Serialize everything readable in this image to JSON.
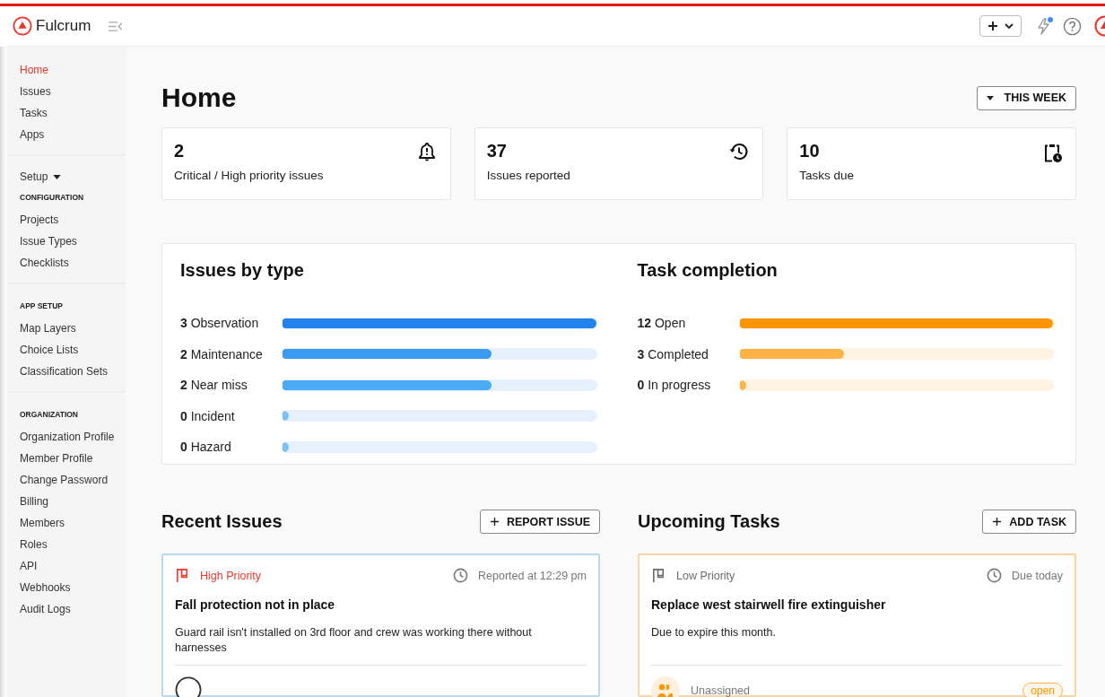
{
  "header": {
    "brand": "Fulcrum",
    "notifications_unread": true
  },
  "sidebar": {
    "groups": [
      {
        "items": [
          {
            "label": "Home",
            "selected": true
          },
          {
            "label": "Issues",
            "selected": false
          },
          {
            "label": "Tasks",
            "selected": false
          },
          {
            "label": "Apps",
            "selected": false
          }
        ]
      },
      {
        "toggle": "Setup",
        "heading": "CONFIGURATION",
        "items": [
          {
            "label": "Projects",
            "selected": false
          },
          {
            "label": "Issue Types",
            "selected": false
          },
          {
            "label": "Checklists",
            "selected": false
          }
        ]
      },
      {
        "heading": "APP SETUP",
        "items": [
          {
            "label": "Map Layers",
            "selected": false
          },
          {
            "label": "Choice Lists",
            "selected": false
          },
          {
            "label": "Classification Sets",
            "selected": false
          }
        ]
      },
      {
        "heading": "ORGANIZATION",
        "items": [
          {
            "label": "Organization Profile",
            "selected": false
          },
          {
            "label": "Member Profile",
            "selected": false
          },
          {
            "label": "Change Password",
            "selected": false
          },
          {
            "label": "Billing",
            "selected": false
          },
          {
            "label": "Members",
            "selected": false
          },
          {
            "label": "Roles",
            "selected": false
          },
          {
            "label": "API",
            "selected": false
          },
          {
            "label": "Webhooks",
            "selected": false
          },
          {
            "label": "Audit Logs",
            "selected": false
          }
        ]
      }
    ]
  },
  "page": {
    "title": "Home",
    "period_button": "THIS WEEK"
  },
  "stats": [
    {
      "kind": "alert",
      "value": "2",
      "label": "Critical / High priority issues"
    },
    {
      "kind": "history",
      "value": "37",
      "label": "Issues reported"
    },
    {
      "kind": "tasks",
      "value": "10",
      "label": "Tasks due"
    }
  ],
  "breakdowns": [
    {
      "title": "Issues by type",
      "rows": [
        {
          "count": "3",
          "label": "Observation",
          "level": 1,
          "color": "#2383ee"
        },
        {
          "count": "2",
          "label": "Maintenance",
          "level": 0.667,
          "color": "#3a9af0"
        },
        {
          "count": "2",
          "label": "Near miss",
          "level": 0.667,
          "color": "#4aacf5"
        },
        {
          "count": "0",
          "label": "Incident",
          "level": 0,
          "color": "#7cc0f8"
        },
        {
          "count": "0",
          "label": "Hazard",
          "level": 0,
          "color": "#7cc0f8"
        }
      ]
    },
    {
      "title": "Task completion",
      "rows": [
        {
          "count": "12",
          "label": "Open",
          "level": 1,
          "color": "#ff9500"
        },
        {
          "count": "3",
          "label": "Completed",
          "level": 0.333,
          "color": "#ffb347"
        },
        {
          "count": "0",
          "label": "In progress",
          "level": 0,
          "color": "#ffb347"
        }
      ]
    }
  ],
  "lists": [
    {
      "kind": "issue",
      "title": "Recent Issues",
      "button": "REPORT ISSUE",
      "card": {
        "priority": "High Priority",
        "color": "#f0392b",
        "time": "Reported at 12:29 pm",
        "title": "Fall protection not in place",
        "description": "Guard rail isn't installed on 3rd floor and crew was working there without harnesses"
      }
    },
    {
      "kind": "task",
      "title": "Upcoming Tasks",
      "button": "ADD TASK",
      "card": {
        "priority": "Low Priority",
        "color": "#6b6b6b",
        "time": "Due today",
        "title": "Replace west stairwell fire extinguisher",
        "description": "Due to expire this month.",
        "assignee": "Unassigned",
        "status": "open"
      }
    }
  ]
}
